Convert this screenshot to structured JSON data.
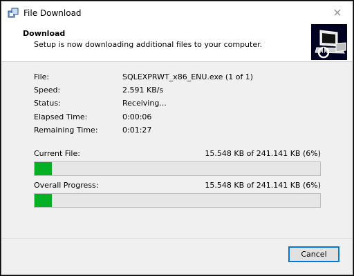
{
  "window": {
    "title": "File Download",
    "close_glyph": "✕"
  },
  "header": {
    "title": "Download",
    "subtitle": "Setup is now downloading additional files to your computer.",
    "art_icon": "computer-download-icon"
  },
  "info": {
    "file_label": "File:",
    "file_value": "SQLEXPRWT_x86_ENU.exe (1 of 1)",
    "speed_label": "Speed:",
    "speed_value": "2.591 KB/s",
    "status_label": "Status:",
    "status_value": "Receiving...",
    "elapsed_label": "Elapsed Time:",
    "elapsed_value": "0:00:06",
    "remaining_label": "Remaining Time:",
    "remaining_value": "0:01:27"
  },
  "current_file": {
    "label": "Current File:",
    "stat": "15.548 KB of 241.141 KB (6%)",
    "progress": 0.06
  },
  "overall": {
    "label": "Overall Progress:",
    "stat": "15.548 KB of 241.141 KB (6%)",
    "progress": 0.06
  },
  "footer": {
    "cancel_label": "Cancel"
  },
  "colors": {
    "progress_fill": "#06b025",
    "button_focus": "#0078d7"
  }
}
